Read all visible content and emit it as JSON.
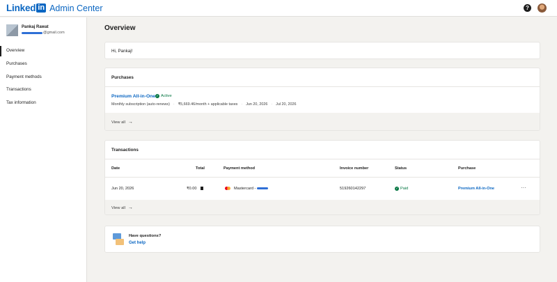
{
  "header": {
    "brand_text": "Linked",
    "brand_box": "in",
    "app_name": "Admin Center",
    "help_icon": "?",
    "icons": {
      "help": "help-icon",
      "avatar": "user-avatar"
    },
    "brand_color": "#0a66c2"
  },
  "sidebar": {
    "profile": {
      "name": "Pankaj Rawat",
      "email_suffix": "@gmail.com"
    },
    "items": [
      {
        "label": "Overview",
        "active": true
      },
      {
        "label": "Purchases",
        "active": false
      },
      {
        "label": "Payment methods",
        "active": false
      },
      {
        "label": "Transactions",
        "active": false
      },
      {
        "label": "Tax information",
        "active": false
      }
    ]
  },
  "main": {
    "title": "Overview",
    "greeting": "Hi, Pankaj!",
    "purchases": {
      "heading": "Purchases",
      "product_name": "Premium All-in-One",
      "status": "Active",
      "billing": "Monthly subscription (auto-renews)",
      "price": "₹5,669.46/month + applicable taxes",
      "start_date": "Jun 20, 2026",
      "end_date": "Jul 20, 2026",
      "view_all": "View all",
      "arrow": "→"
    },
    "transactions": {
      "heading": "Transactions",
      "columns": [
        "Date",
        "Total",
        "Payment method",
        "Invoice number",
        "Status",
        "Purchase"
      ],
      "rows": [
        {
          "date": "Jun 20, 2026",
          "total": "₹0.00",
          "payment_method": "Mastercard -",
          "invoice_number": "519260142297",
          "status": "Paid",
          "purchase": "Premium All-in-One",
          "more": "···"
        }
      ],
      "view_all": "View all",
      "arrow": "→"
    },
    "help": {
      "title": "Have questions?",
      "link": "Get help"
    }
  },
  "colors": {
    "accent": "#0a66c2",
    "success": "#057642",
    "background": "#f3f2ef"
  }
}
